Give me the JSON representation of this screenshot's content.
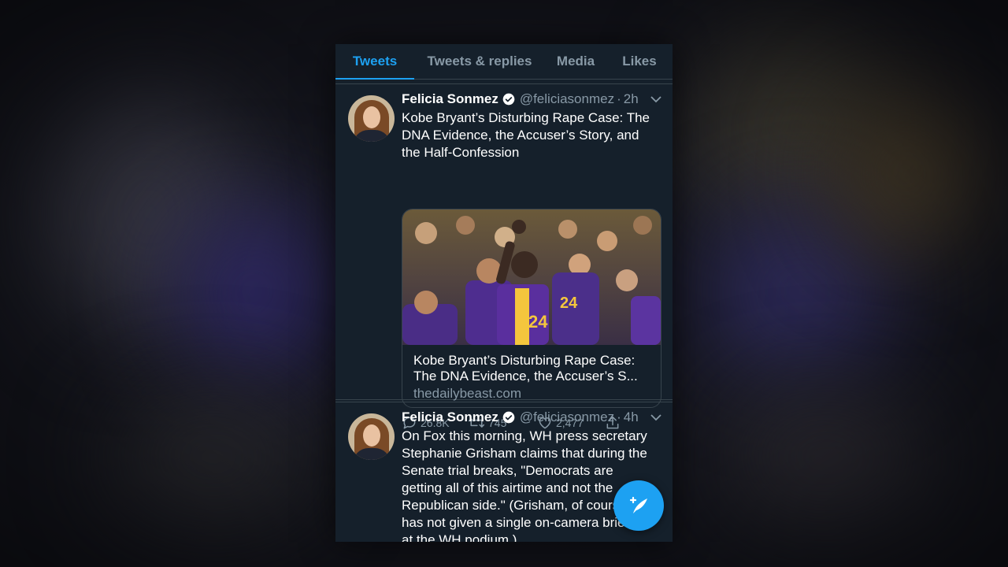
{
  "tabs": [
    "Tweets",
    "Tweets & replies",
    "Media",
    "Likes"
  ],
  "active_tab": "Tweets",
  "tweets": [
    {
      "name": "Felicia Sonmez",
      "handle": "@feliciasonmez",
      "time": "2h",
      "lines": [
        "Kobe Bryant’s Disturbing Rape Case: The",
        "DNA Evidence, the Accuser’s Story, and",
        "the Half-Confession"
      ],
      "card": {
        "title_lines": [
          "Kobe Bryant’s Disturbing Rape Case:",
          "The DNA Evidence, the Accuser’s S..."
        ],
        "domain": "thedailybeast.com"
      },
      "replies": "26.8K",
      "retweets": "745",
      "likes": "2,477"
    },
    {
      "name": "Felicia Sonmez",
      "handle": "@feliciasonmez",
      "time": "4h",
      "lines": [
        "On Fox this morning, WH press secretary",
        "Stephanie Grisham claims that during the",
        "Senate trial breaks, \"Democrats are",
        "getting all of this airtime and not the",
        "Republican side.\" (Grisham, of course,",
        "has not given a single on-camera briefing",
        "at the WH podium.)"
      ]
    }
  ],
  "colors": {
    "background": "#15202b",
    "accent": "#1da1f2",
    "text": "#ffffff",
    "muted": "#8899a6",
    "border": "#38444d"
  },
  "icons": [
    "verified-badge-icon",
    "chevron-down-icon",
    "reply-icon",
    "retweet-icon",
    "like-icon",
    "share-icon",
    "compose-tweet-icon"
  ]
}
